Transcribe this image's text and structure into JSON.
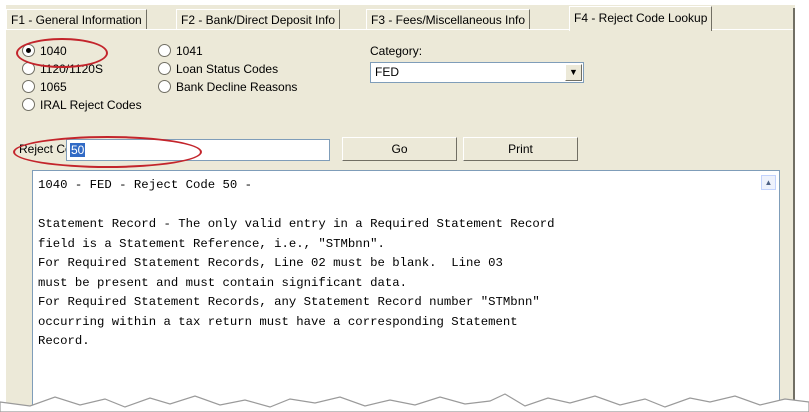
{
  "tabs": [
    {
      "label": "F1 - General Information"
    },
    {
      "label": "F2 - Bank/Direct Deposit Info"
    },
    {
      "label": "F3 - Fees/Miscellaneous Info"
    },
    {
      "label": "F4 - Reject Code Lookup"
    }
  ],
  "return_types": [
    {
      "label": "1040",
      "selected": true
    },
    {
      "label": "1120/1120S",
      "selected": false
    },
    {
      "label": "1065",
      "selected": false
    },
    {
      "label": "IRAL Reject Codes",
      "selected": false
    },
    {
      "label": "1041",
      "selected": false
    },
    {
      "label": "Loan Status Codes",
      "selected": false
    },
    {
      "label": "Bank Decline Reasons",
      "selected": false
    }
  ],
  "category": {
    "label": "Category:",
    "value": "FED"
  },
  "reject_code": {
    "label": "Reject Code:",
    "value": "50"
  },
  "buttons": {
    "go": "Go",
    "print": "Print"
  },
  "result_text": "1040 - FED - Reject Code 50 -\n\nStatement Record - The only valid entry in a Required Statement Record\nfield is a Statement Reference, i.e., \"STMbnn\".\nFor Required Statement Records, Line 02 must be blank.  Line 03\nmust be present and must contain significant data.\nFor Required Statement Records, any Statement Record number \"STMbnn\"\noccurring within a tax return must have a corresponding Statement\nRecord.",
  "colors": {
    "highlight_oval": "#c3242b",
    "selection": "#316ac5",
    "panel": "#ece9d8"
  }
}
